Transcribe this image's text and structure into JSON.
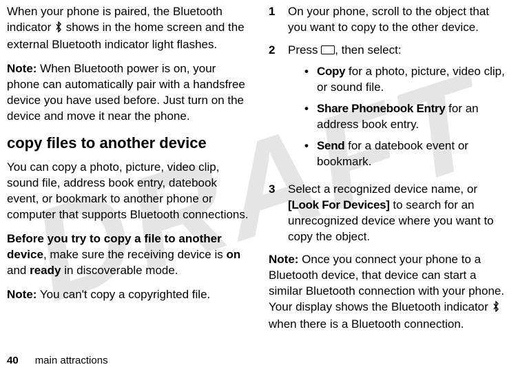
{
  "watermark": "DRAFT",
  "left": {
    "p1_a": "When your phone is paired, the Bluetooth indicator ",
    "p1_b": " shows in the home screen and the external Bluetooth indicator light flashes.",
    "p2_note": "Note:",
    "p2_body": " When Bluetooth power is on, your phone can automatically pair with a handsfree device you have used before. Just turn on the device and move it near the phone.",
    "h2": "copy files to another device",
    "p3": "You can copy a photo, picture, video clip, sound file, address book entry, datebook event, or bookmark to another phone or computer that supports Bluetooth connections.",
    "p4_lead": "Before you try to copy a file to another device",
    "p4_mid1": ", make sure the receiving device is ",
    "p4_on": "on",
    "p4_mid2": " and ",
    "p4_ready": "ready",
    "p4_tail": " in discoverable mode.",
    "p5_note": "Note:",
    "p5_body": " You can't copy a copyrighted file."
  },
  "right": {
    "s1_num": "1",
    "s1_body": "On your phone, scroll to the object that you want to copy to the other device.",
    "s2_num": "2",
    "s2_a": "Press ",
    "s2_b": ", then select:",
    "b1_label": "Copy",
    "b1_body": " for a photo, picture, video clip, or sound file.",
    "b2_label": "Share Phonebook Entry",
    "b2_body": " for an address book entry.",
    "b3_label": "Send",
    "b3_body": " for a datebook event or bookmark.",
    "s3_num": "3",
    "s3_a": "Select a recognized device name, or ",
    "s3_look": "[Look For Devices]",
    "s3_b": " to search for an unrecognized device where you want to copy the object.",
    "note_label": "Note:",
    "note_a": " Once you connect your phone to a Bluetooth device, that device can start a similar Bluetooth connection with your phone. Your display shows the Bluetooth indicator ",
    "note_b": " when there is a Bluetooth connection."
  },
  "footer": {
    "page": "40",
    "section": "main attractions"
  }
}
